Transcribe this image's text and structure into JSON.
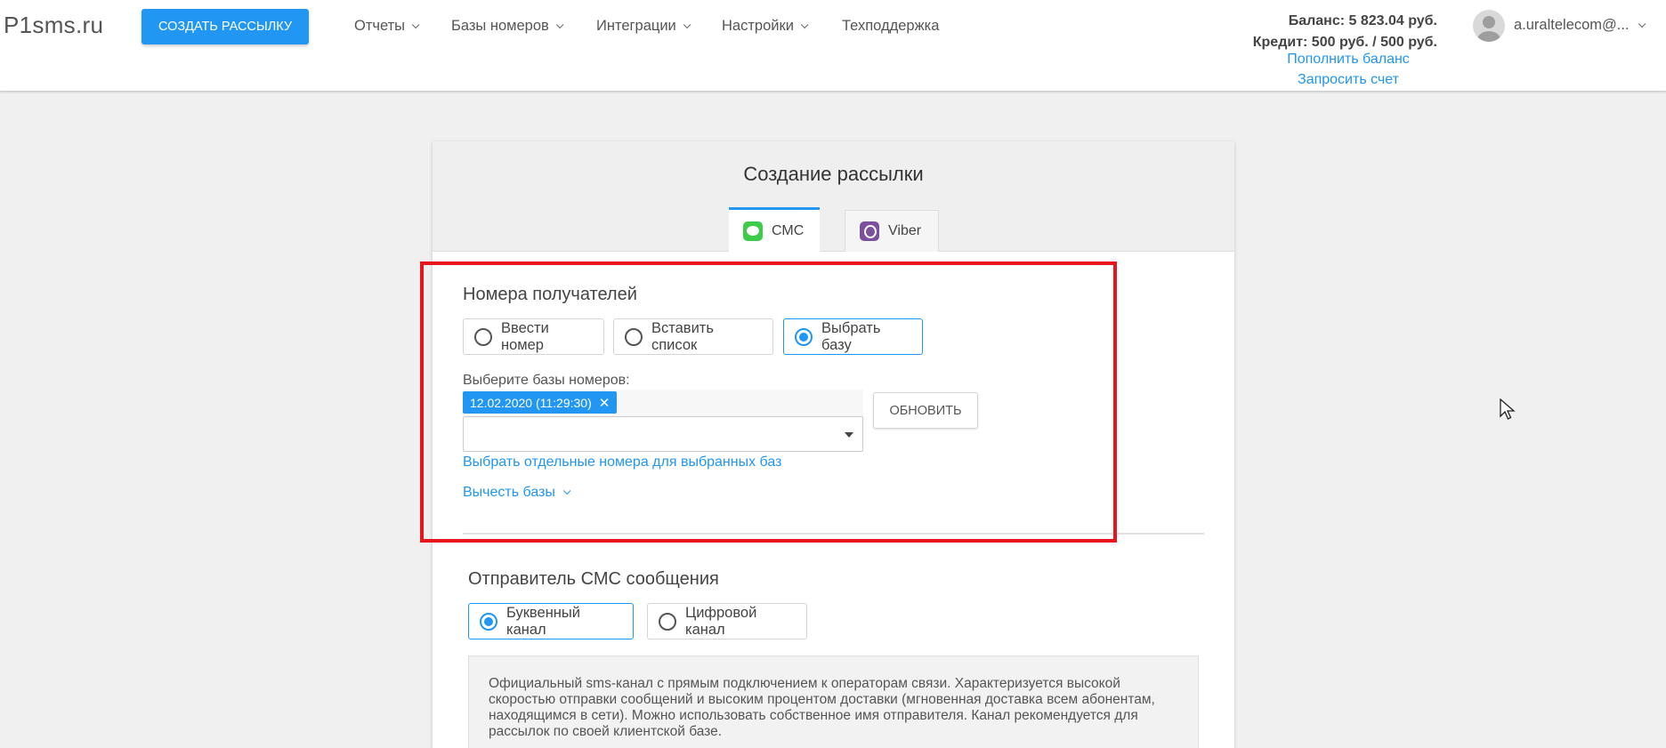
{
  "header": {
    "logo": "P1sms.ru",
    "create_button": "СОЗДАТЬ РАССЫЛКУ",
    "nav": [
      {
        "label": "Отчеты"
      },
      {
        "label": "Базы номеров"
      },
      {
        "label": "Интеграции"
      },
      {
        "label": "Настройки"
      },
      {
        "label": "Техподдержка"
      }
    ],
    "balance": "Баланс: 5 823.04 руб.",
    "credit": "Кредит: 500 руб. / 500 руб.",
    "topup_link": "Пополнить баланс",
    "invoice_link": "Запросить счет",
    "user": "a.uraltelecom@..."
  },
  "card": {
    "title": "Создание рассылки",
    "tabs": [
      {
        "label": "СМС",
        "icon": "sms-icon",
        "active": true
      },
      {
        "label": "Viber",
        "icon": "viber-icon",
        "active": false
      }
    ]
  },
  "recipients": {
    "title": "Номера получателей",
    "options": [
      {
        "label": "Ввести номер",
        "selected": false
      },
      {
        "label": "Вставить список",
        "selected": false
      },
      {
        "label": "Выбрать базу",
        "selected": true
      }
    ],
    "bases_label": "Выберите базы номеров:",
    "selected_base": "12.02.2020 (11:29:30)",
    "refresh_button": "ОБНОВИТЬ",
    "select_numbers_link": "Выбрать отдельные номера для выбранных баз",
    "subtract_link": "Вычесть базы"
  },
  "sender": {
    "title": "Отправитель СМС сообщения",
    "options": [
      {
        "label": "Буквенный канал",
        "selected": true
      },
      {
        "label": "Цифровой канал",
        "selected": false
      }
    ],
    "description": "Официальный sms-канал с прямым подключением к операторам связи. Характеризуется высокой скоростью отправки сообщений и высоким процентом доставки (мгновенная доставка всем абонентам, находящимся в сети). Можно использовать собственное имя отправителя. Канал рекомендуется для рассылок по своей клиентской базе."
  },
  "colors": {
    "accent": "#2196f3",
    "highlight": "#e8161c"
  }
}
